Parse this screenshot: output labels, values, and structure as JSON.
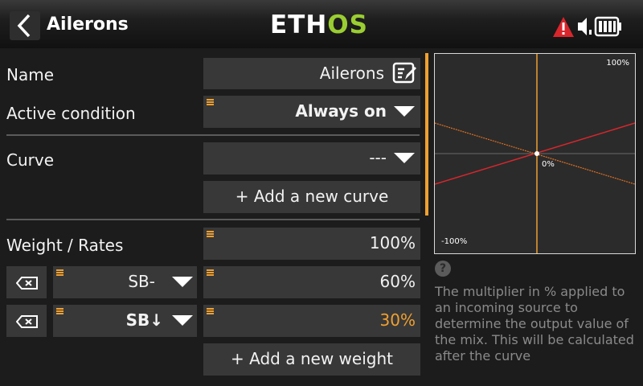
{
  "header": {
    "title": "Ailerons",
    "logo_main": "ETH",
    "logo_accent": "OS",
    "icons": [
      "back-arrow-icon",
      "warning-icon",
      "speaker-muted-icon",
      "battery-icon"
    ]
  },
  "form": {
    "name": {
      "label": "Name",
      "value": "Ailerons"
    },
    "active_condition": {
      "label": "Active condition",
      "value": "Always on"
    },
    "curve": {
      "label": "Curve",
      "value": "---",
      "add_button": "+ Add a new curve"
    },
    "weight": {
      "label": "Weight / Rates",
      "value": "100%",
      "rates": [
        {
          "switch": "SB-",
          "value": "60%",
          "active": false
        },
        {
          "switch": "SB↓",
          "value": "30%",
          "active": true
        }
      ],
      "add_button": "+ Add a new weight"
    }
  },
  "graph": {
    "top_label": "100%",
    "center_label": "0%",
    "bottom_label": "-100%"
  },
  "help": {
    "icon": "?",
    "text": "The multiplier in % applied to an incoming source to determine the output value of the mix. This will be calculated after the curve"
  },
  "colors": {
    "accent": "#f0a030",
    "logo_accent": "#9acd32",
    "line_red": "#d8262c"
  }
}
